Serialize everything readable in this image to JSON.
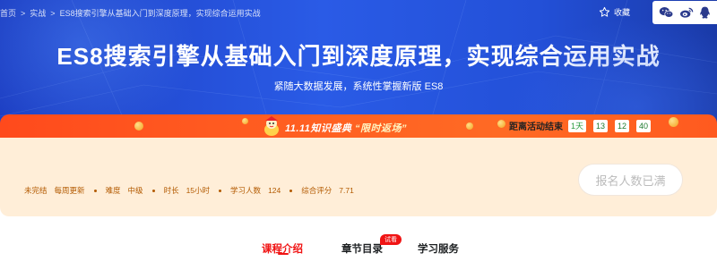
{
  "breadcrumb": {
    "items": [
      "首页",
      "实战",
      "ES8搜索引擎从基础入门到深度原理，实现综合运用实战"
    ],
    "separator": ">"
  },
  "header": {
    "collect_label": "收藏",
    "share_icons": [
      "wechat-icon",
      "weibo-icon",
      "qq-icon"
    ]
  },
  "hero": {
    "title": "ES8搜索引擎从基础入门到深度原理，实现综合运用实战",
    "subtitle": "紧随大数据发展，系统性掌握新版 ES8"
  },
  "promo": {
    "headline_prefix": "11.11知识盛典",
    "headline_tag": "“限时返场”",
    "countdown_label": "距离活动结束",
    "countdown": {
      "days": "1天",
      "hours": "13",
      "minutes": "12",
      "seconds": "40"
    }
  },
  "course_info": {
    "status": "未完结",
    "update": "每周更新",
    "difficulty_label": "难度",
    "difficulty_value": "中级",
    "duration_label": "时长",
    "duration_value": "15小时",
    "learners_label": "学习人数",
    "learners_value": "124",
    "rating_label": "综合评分",
    "rating_value": "7.71"
  },
  "signup_button": "报名人数已满",
  "tabs": [
    {
      "label": "课程介绍",
      "active": true
    },
    {
      "label": "章节目录",
      "badge": "试看"
    },
    {
      "label": "学习服务"
    }
  ],
  "colors": {
    "hero_blue": "#2a5be6",
    "promo_orange": "#ff5a20",
    "accent_red": "#f01414",
    "info_bg": "#ffeed8",
    "info_text": "#b35a00"
  }
}
